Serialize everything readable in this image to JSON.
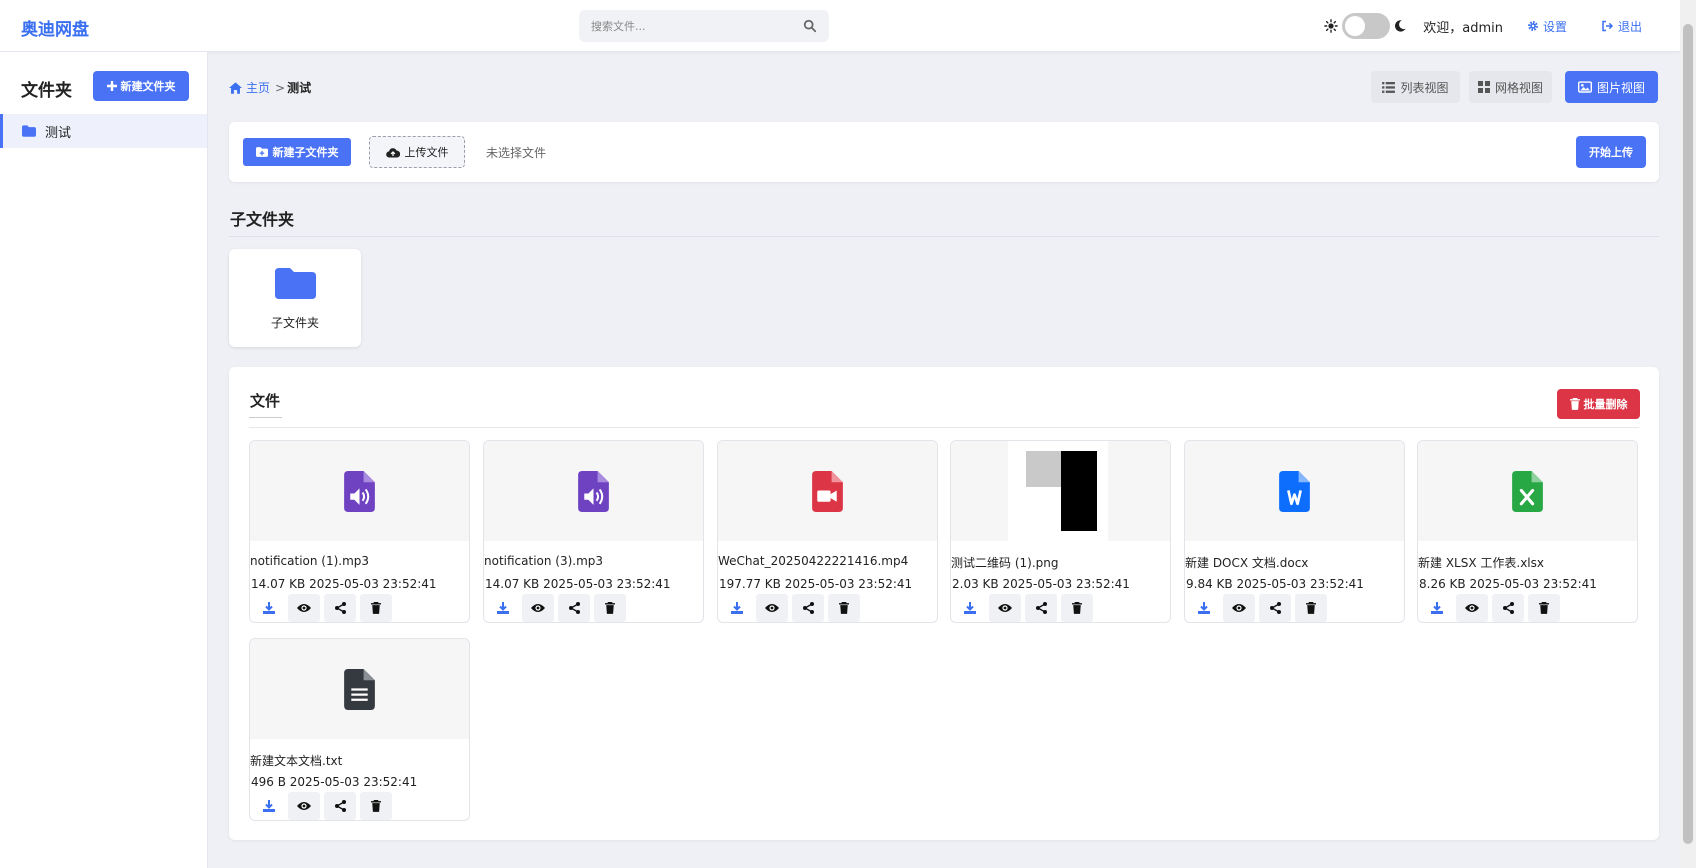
{
  "app": {
    "brand": "奥迪网盘"
  },
  "search": {
    "placeholder": "搜索文件..."
  },
  "nav": {
    "welcome": "欢迎，admin",
    "settings": "设置",
    "logout": "退出"
  },
  "sidebar": {
    "title": "文件夹",
    "new_folder": "新建文件夹",
    "items": [
      {
        "label": "测试"
      }
    ]
  },
  "breadcrumb": {
    "home": "主页",
    "separator": ">",
    "current": "测试"
  },
  "views": {
    "list": "列表视图",
    "grid": "网格视图",
    "image": "图片视图",
    "active": "图片视图"
  },
  "upload": {
    "new_subfolder": "新建子文件夹",
    "upload_file": "上传文件",
    "no_file": "未选择文件",
    "start": "开始上传"
  },
  "subfolders": {
    "title": "子文件夹",
    "items": [
      {
        "name": "子文件夹"
      }
    ]
  },
  "files": {
    "title": "文件",
    "batch_delete": "批量删除",
    "items": [
      {
        "name": "notification (1).mp3",
        "meta": "14.07 KB 2025-05-03 23:52:41",
        "icon": "audio-file-icon"
      },
      {
        "name": "notification (3).mp3",
        "meta": "14.07 KB 2025-05-03 23:52:41",
        "icon": "audio-file-icon"
      },
      {
        "name": "WeChat_20250422221416.mp4",
        "meta": "197.77 KB 2025-05-03 23:52:41",
        "icon": "video-file-icon"
      },
      {
        "name": "测试二维码 (1).png",
        "meta": "2.03 KB 2025-05-03 23:52:41",
        "icon": "image-thumbnail"
      },
      {
        "name": "新建 DOCX 文档.docx",
        "meta": "9.84 KB 2025-05-03 23:52:41",
        "icon": "word-file-icon"
      },
      {
        "name": "新建 XLSX 工作表.xlsx",
        "meta": "8.26 KB 2025-05-03 23:52:41",
        "icon": "excel-file-icon"
      },
      {
        "name": "新建文本文档.txt",
        "meta": "496 B 2025-05-03 23:52:41",
        "icon": "text-file-icon"
      }
    ]
  },
  "colors": {
    "accent": "#4a72f5",
    "danger": "#dc3545",
    "audio": "#6f42c1",
    "video": "#dc3545",
    "word": "#0d6efd",
    "excel": "#28a745",
    "text": "#343a40"
  }
}
